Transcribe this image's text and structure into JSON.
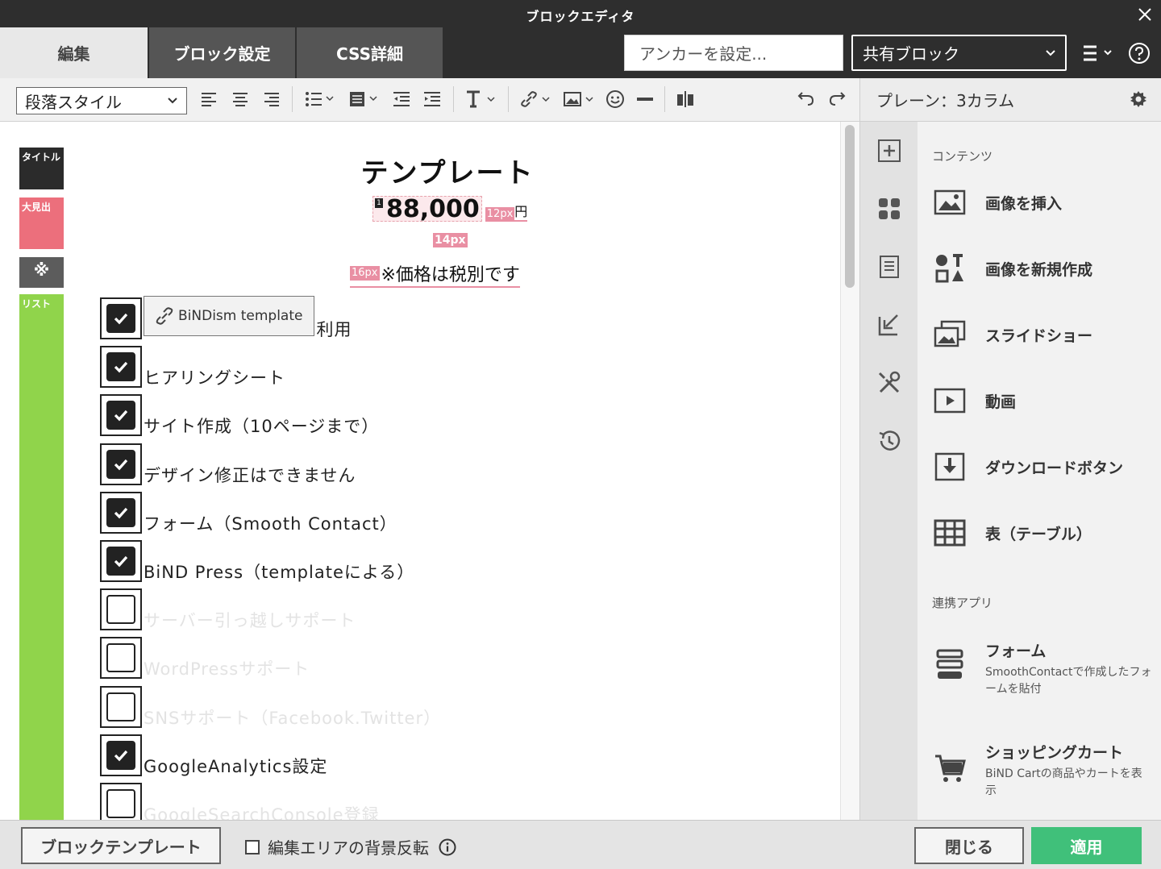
{
  "window": {
    "title": "ブロックエディタ"
  },
  "tabs": [
    {
      "label": "編集",
      "active": true
    },
    {
      "label": "ブロック設定",
      "active": false
    },
    {
      "label": "CSS詳細",
      "active": false
    }
  ],
  "header": {
    "anchor_label": "アンカーを設定...",
    "shared_block_value": "共有ブロック"
  },
  "toolbar": {
    "paragraph_style": "段落スタイル"
  },
  "right_panel": {
    "layout_label": "プレーン：3カラム",
    "contents_heading": "コンテンツ",
    "items": [
      {
        "label": "画像を挿入",
        "icon": "image-icon"
      },
      {
        "label": "画像を新規作成",
        "icon": "shapes-icon"
      },
      {
        "label": "スライドショー",
        "icon": "slideshow-icon"
      },
      {
        "label": "動画",
        "icon": "video-icon"
      },
      {
        "label": "ダウンロードボタン",
        "icon": "download-icon"
      },
      {
        "label": "表（テーブル）",
        "icon": "table-icon"
      }
    ],
    "apps_heading": "連携アプリ",
    "apps": [
      {
        "label": "フォーム",
        "desc": "SmoothContactで作成したフォームを貼付",
        "icon": "form-icon"
      },
      {
        "label": "ショッピングカート",
        "desc": "BiND Cartの商品やカートを表示",
        "icon": "cart-icon"
      }
    ]
  },
  "editor": {
    "tags": {
      "title": "タイトル",
      "big_heading": "大見出",
      "note": "※",
      "list": "リスト"
    },
    "doc_title": "テンプレート",
    "price_marker": "1",
    "price": "88,000",
    "price_size_badge": "12px",
    "price_unit": "円",
    "size_badge_14": "14px",
    "note_size_badge": "16px",
    "note_text": "※価格は税別です",
    "link_button": "BiNDism template",
    "list": [
      {
        "text": "利用",
        "checked": true
      },
      {
        "text": "ヒアリングシート",
        "checked": true
      },
      {
        "text": "サイト作成（10ページまで）",
        "checked": true
      },
      {
        "text": "デザイン修正はできません",
        "checked": true
      },
      {
        "text": "フォーム（Smooth Contact）",
        "checked": true
      },
      {
        "text": "BiND Press（templateによる）",
        "checked": true
      },
      {
        "text": "サーバー引っ越しサポート",
        "checked": false
      },
      {
        "text": "WordPressサポート",
        "checked": false
      },
      {
        "text": "SNSサポート（Facebook.Twitter）",
        "checked": false
      },
      {
        "text": "GoogleAnalytics設定",
        "checked": true
      },
      {
        "text": "GoogleSearchConsole登録",
        "checked": false
      }
    ]
  },
  "footer": {
    "template_button": "ブロックテンプレート",
    "bg_invert_label": "編集エリアの背景反転",
    "close_button": "閉じる",
    "apply_button": "適用"
  }
}
